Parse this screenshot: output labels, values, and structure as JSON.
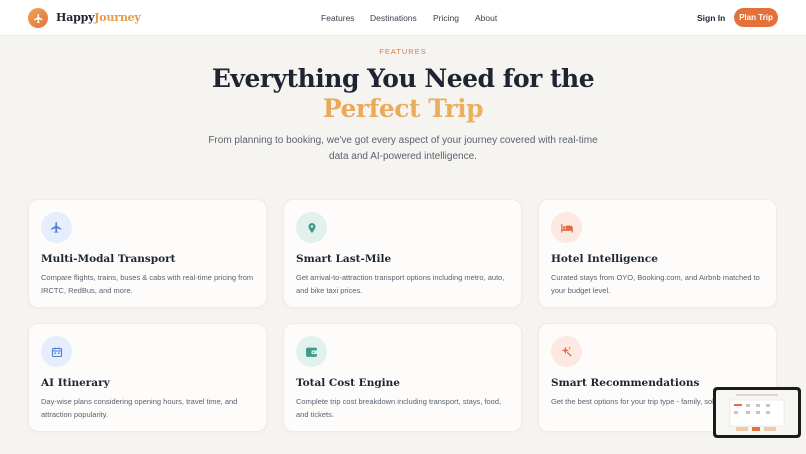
{
  "nav": {
    "brand_primary": "Happy",
    "brand_accent": "Journey",
    "links": [
      "Features",
      "Destinations",
      "Pricing",
      "About"
    ],
    "signin": "Sign In",
    "cta": "Plan Trip"
  },
  "hero": {
    "eyebrow": "FEATURES",
    "headline_line1": "Everything You Need for the",
    "headline_line2": "Perfect Trip",
    "subtitle": "From planning to booking, we've got every aspect of your journey covered with real-time data and AI-powered intelligence."
  },
  "cards": [
    {
      "icon": "plane-icon",
      "title": "Multi-Modal Transport",
      "desc": "Compare flights, trains, buses & cabs with real-time pricing from IRCTC, RedBus, and more."
    },
    {
      "icon": "map-pin-icon",
      "title": "Smart Last-Mile",
      "desc": "Get arrival-to-attraction transport options including metro, auto, and bike taxi prices."
    },
    {
      "icon": "bed-icon",
      "title": "Hotel Intelligence",
      "desc": "Curated stays from OYO, Booking.com, and Airbnb matched to your budget level."
    },
    {
      "icon": "calendar-icon",
      "title": "AI Itinerary",
      "desc": "Day-wise plans considering opening hours, travel time, and attraction popularity."
    },
    {
      "icon": "wallet-icon",
      "title": "Total Cost Engine",
      "desc": "Complete trip cost breakdown including transport, stays, food, and tickets."
    },
    {
      "icon": "sparkle-icon",
      "title": "Smart Recommendations",
      "desc": "Get the best options for your trip type - family, solo, or couple."
    }
  ],
  "colors": {
    "accent": "#e2713a",
    "blue": "#4f7fd6",
    "teal": "#3f9a8c",
    "peach": "#e06a44"
  }
}
